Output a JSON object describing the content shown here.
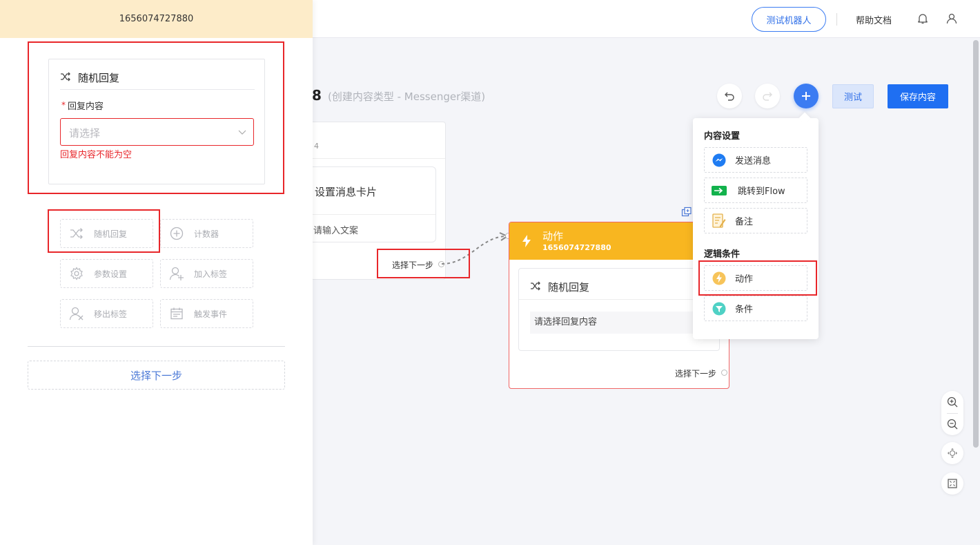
{
  "header": {
    "test_robot_label": "测试机器人",
    "help_label": "帮助文档",
    "bell_icon": "bell-icon",
    "user_icon": "user-icon"
  },
  "page": {
    "title_num": "8",
    "subtitle": "(创建内容类型 - Messenger渠道)"
  },
  "toolbar": {
    "test_label": "测试",
    "save_label": "保存内容"
  },
  "left_node": {
    "digit": "4",
    "card_title": "设置消息卡片",
    "card_placeholder": "请输入文案",
    "next_step": "选择下一步"
  },
  "action_node": {
    "title": "动作",
    "id": "1656074727880",
    "inner_title": "随机回复",
    "inner_select": "请选择回复内容",
    "next_step": "选择下一步"
  },
  "menu": {
    "section1": "内容设置",
    "items1": [
      {
        "label": "发送消息",
        "icon": "messenger-icon"
      },
      {
        "label": "跳转到Flow",
        "icon": "flow-jump-icon"
      },
      {
        "label": "备注",
        "icon": "note-icon"
      }
    ],
    "section2": "逻辑条件",
    "items2": [
      {
        "label": "动作",
        "icon": "bolt-icon"
      },
      {
        "label": "条件",
        "icon": "filter-icon"
      }
    ]
  },
  "drawer": {
    "header_id": "1656074727880",
    "card_title": "随机回复",
    "required_star": "*",
    "field_label": "回复内容",
    "select_placeholder": "请选择",
    "error_text": "回复内容不能为空",
    "tools": [
      {
        "label": "随机回复",
        "icon": "shuffle-icon"
      },
      {
        "label": "计数器",
        "icon": "plus-circle-icon"
      },
      {
        "label": "参数设置",
        "icon": "gear-icon"
      },
      {
        "label": "加入标签",
        "icon": "user-add-icon"
      },
      {
        "label": "移出标签",
        "icon": "user-remove-icon"
      },
      {
        "label": "触发事件",
        "icon": "calendar-icon"
      }
    ],
    "next_step": "选择下一步"
  },
  "colors": {
    "primary": "#1f6ff2",
    "action_header": "#f8b620",
    "highlight_red": "#e8262a",
    "drawer_header": "#fdecc9"
  }
}
